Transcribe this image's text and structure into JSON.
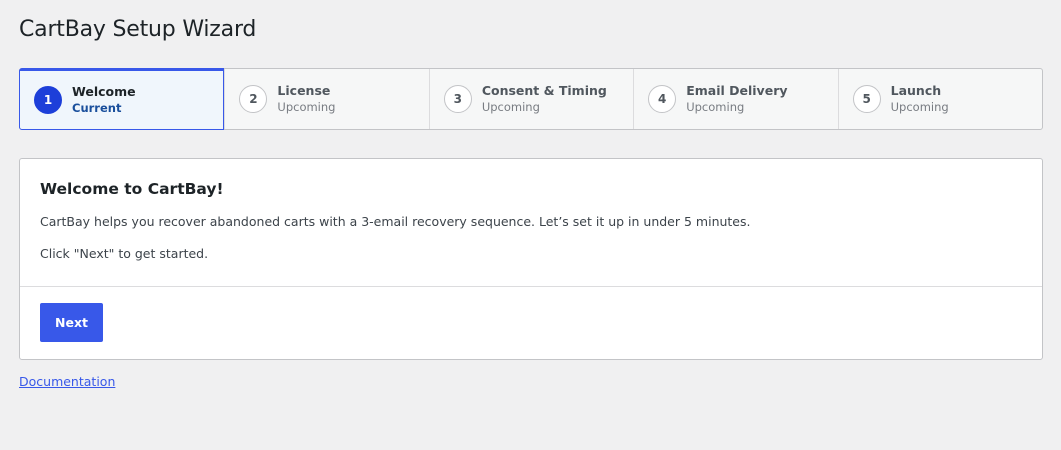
{
  "page": {
    "title": "CartBay Setup Wizard"
  },
  "steps": [
    {
      "number": "1",
      "name": "Welcome",
      "status": "Current",
      "active": true
    },
    {
      "number": "2",
      "name": "License",
      "status": "Upcoming",
      "active": false
    },
    {
      "number": "3",
      "name": "Consent & Timing",
      "status": "Upcoming",
      "active": false
    },
    {
      "number": "4",
      "name": "Email Delivery",
      "status": "Upcoming",
      "active": false
    },
    {
      "number": "5",
      "name": "Launch",
      "status": "Upcoming",
      "active": false
    }
  ],
  "card": {
    "heading": "Welcome to CartBay!",
    "paragraph1": "CartBay helps you recover abandoned carts with a 3-email recovery sequence. Let’s set it up in under 5 minutes.",
    "paragraph2": "Click \"Next\" to get started.",
    "next_label": "Next"
  },
  "footer": {
    "documentation_link": "Documentation"
  },
  "colors": {
    "accent": "#3858e9",
    "active_circle": "#1d3fd9",
    "background": "#f0f0f1"
  }
}
